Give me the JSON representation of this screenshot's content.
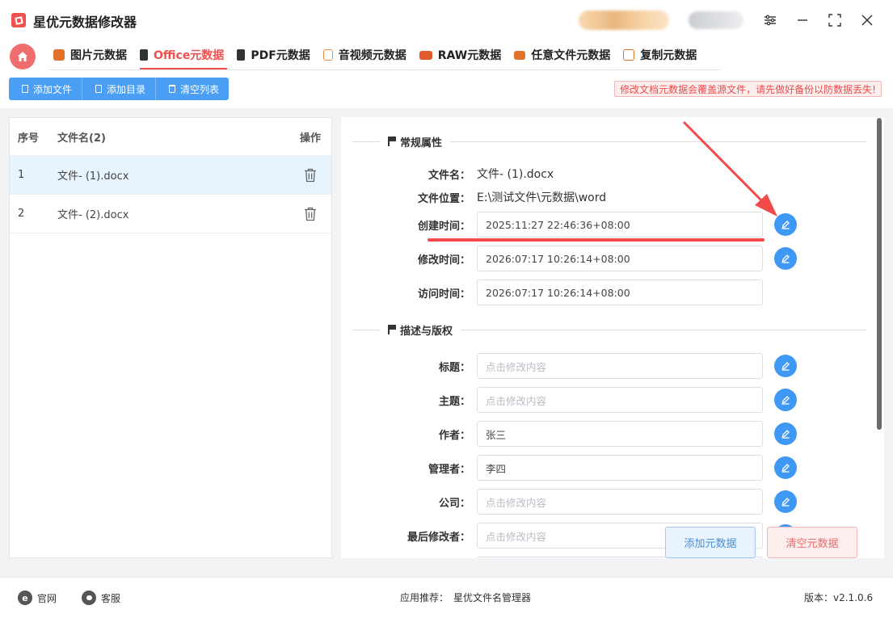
{
  "app": {
    "title": "星优元数据修改器",
    "version_label": "版本：v2.1.0.6"
  },
  "window_controls": [
    "settings-sliders-icon",
    "minimize-icon",
    "maximize-icon",
    "close-icon"
  ],
  "tabs": [
    {
      "label": "图片元数据",
      "icon": "image-icon",
      "color": "#e0722c",
      "active": false
    },
    {
      "label": "Office元数据",
      "icon": "office-icon",
      "color": "#333333",
      "active": true
    },
    {
      "label": "PDF元数据",
      "icon": "pdf-icon",
      "color": "#333333",
      "active": false
    },
    {
      "label": "音视频元数据",
      "icon": "video-icon",
      "color": "#f08a3c",
      "active": false
    },
    {
      "label": "RAW元数据",
      "icon": "raw-icon",
      "color": "#e05a2a",
      "active": false
    },
    {
      "label": "任意文件元数据",
      "icon": "file-icon",
      "color": "#e0722c",
      "active": false
    },
    {
      "label": "复制元数据",
      "icon": "copy-icon",
      "color": "#e0722c",
      "active": false
    }
  ],
  "toolbar": {
    "add_file": "添加文件",
    "add_folder": "添加目录",
    "clear_list": "清空列表"
  },
  "warning": "修改文档元数据会覆盖源文件，请先做好备份以防数据丢失!",
  "file_list": {
    "columns": [
      "序号",
      "文件名(2)",
      "操作"
    ],
    "rows": [
      {
        "index": "1",
        "name": "文件- (1).docx",
        "selected": true
      },
      {
        "index": "2",
        "name": "文件- (2).docx",
        "selected": false
      }
    ]
  },
  "properties": {
    "general_section": "常规属性",
    "file_name_label": "文件名：",
    "file_name": "文件- (1).docx",
    "file_path_label": "文件位置：",
    "file_path": "E:\\测试文件\\元数据\\word",
    "created_label": "创建时间：",
    "created": "2025:11:27 22:46:36+08:00",
    "modified_label": "修改时间：",
    "modified": "2026:07:17 10:26:14+08:00",
    "accessed_label": "访问时间：",
    "accessed": "2026:07:17 10:26:14+08:00",
    "desc_section": "描述与版权",
    "title_label": "标题：",
    "title_placeholder": "点击修改内容",
    "subject_label": "主题：",
    "subject_placeholder": "点击修改内容",
    "author_label": "作者：",
    "author": "张三",
    "manager_label": "管理者：",
    "manager": "李四",
    "company_label": "公司：",
    "company_placeholder": "点击修改内容",
    "last_modified_by_label": "最后修改者：",
    "last_modified_by_placeholder": "点击修改内容"
  },
  "actions": {
    "add_metadata": "添加元数据",
    "clear_metadata": "清空元数据"
  },
  "footer": {
    "website": "官网",
    "support": "客服",
    "recommend_label": "应用推荐：",
    "recommend_app": "星优文件名管理器"
  },
  "colors": {
    "accent_red": "#f05050",
    "button_blue": "#4a9ff5",
    "edit_blue": "#3f98f3"
  }
}
